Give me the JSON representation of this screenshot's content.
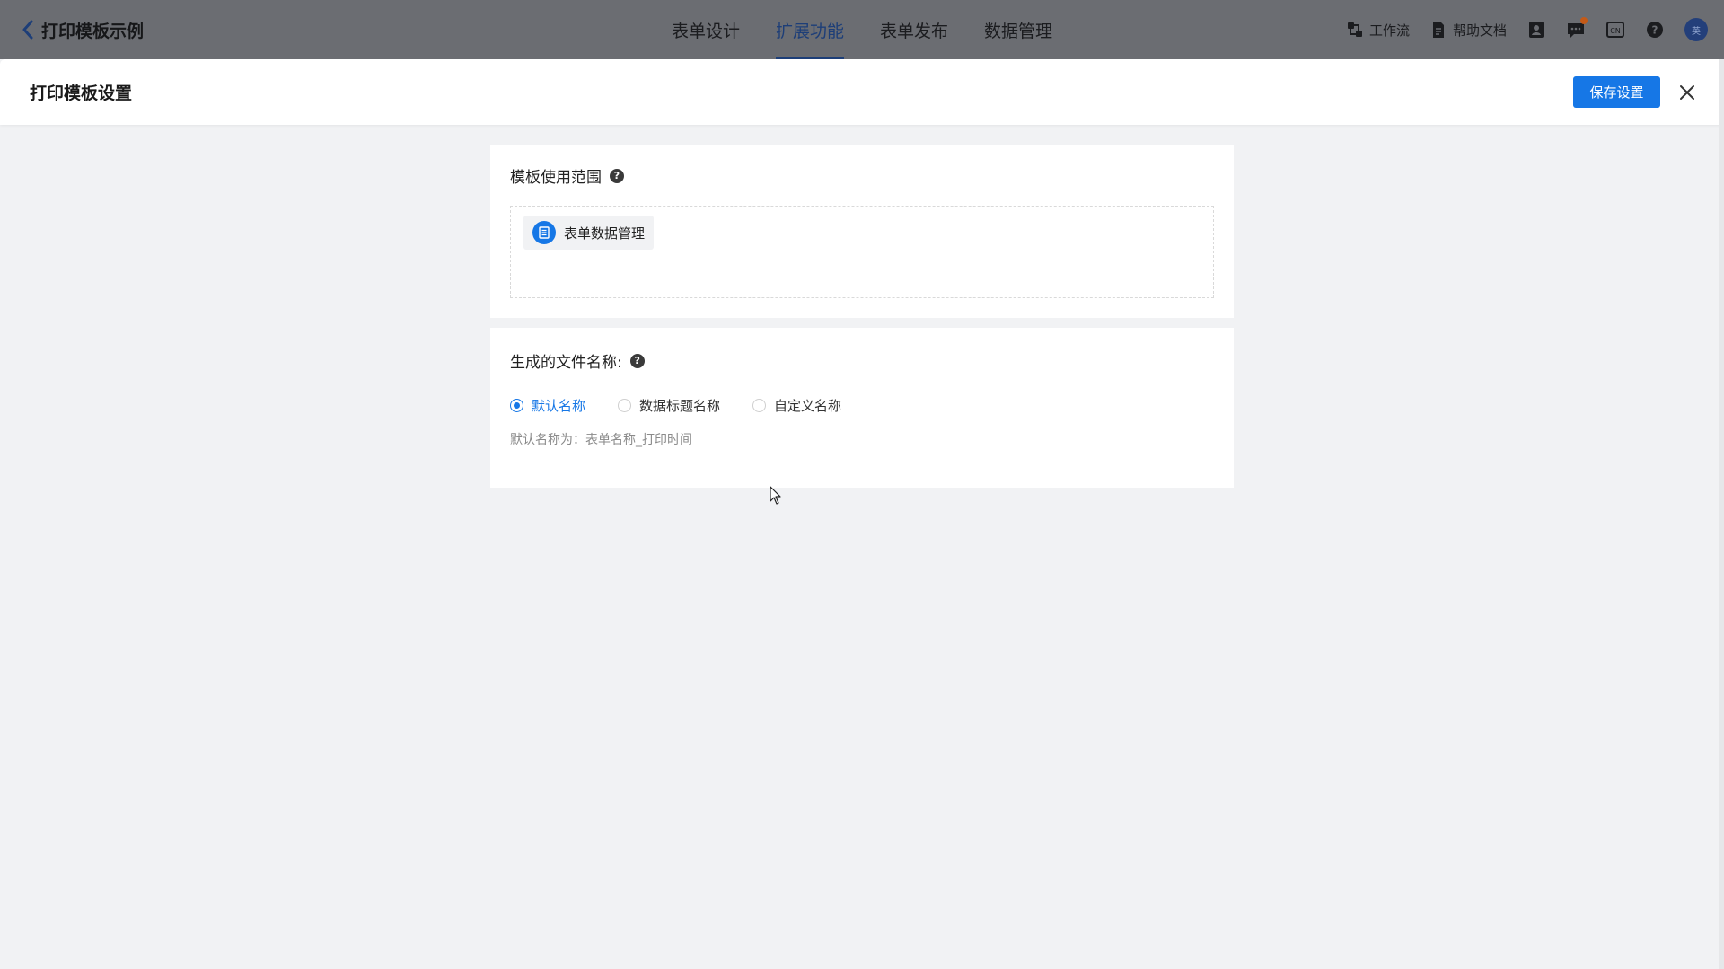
{
  "topbar": {
    "back_title": "打印模板示例",
    "tabs": [
      {
        "label": "表单设计",
        "active": false
      },
      {
        "label": "扩展功能",
        "active": true
      },
      {
        "label": "表单发布",
        "active": false
      },
      {
        "label": "数据管理",
        "active": false
      }
    ],
    "tools": {
      "workflow_label": "工作流",
      "help_docs_label": "帮助文档",
      "language_label": "CN",
      "avatar_label": "英"
    }
  },
  "drawer": {
    "title": "打印模板设置",
    "save_label": "保存设置"
  },
  "scope_section": {
    "label": "模板使用范围",
    "tag_label": "表单数据管理"
  },
  "filename_section": {
    "label": "生成的文件名称:",
    "options": [
      {
        "label": "默认名称",
        "checked": true
      },
      {
        "label": "数据标题名称",
        "checked": false
      },
      {
        "label": "自定义名称",
        "checked": false
      }
    ],
    "hint": "默认名称为：表单名称_打印时间"
  },
  "colors": {
    "accent": "#1677e6",
    "topbar_dimmed": "#6b6d72",
    "background": "#f1f2f4"
  },
  "icons": [
    "chevron-left-icon",
    "workflow-icon",
    "document-icon",
    "contacts-icon",
    "message-icon",
    "language-icon",
    "help-icon",
    "close-icon",
    "list-icon",
    "cursor-icon"
  ]
}
